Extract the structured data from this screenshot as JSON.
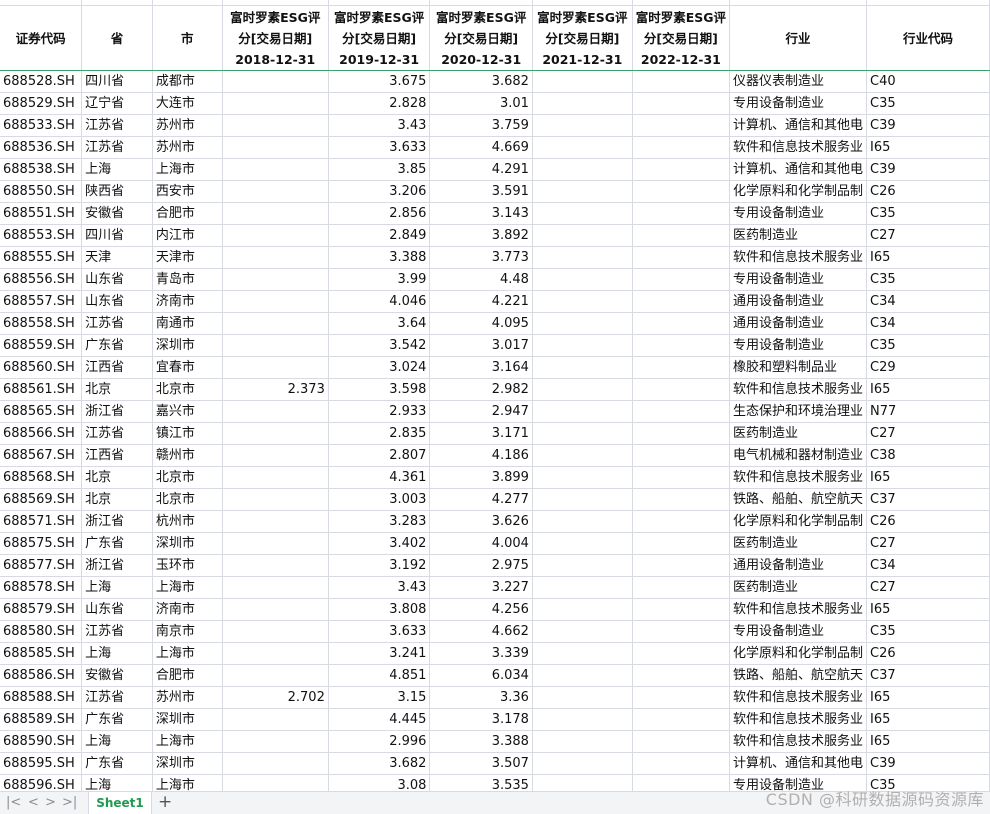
{
  "headers": [
    {
      "lines": [
        "证券代码"
      ]
    },
    {
      "lines": [
        "省"
      ]
    },
    {
      "lines": [
        "市"
      ]
    },
    {
      "lines": [
        "富时罗素ESG评",
        "分[交易日期]",
        "2018-12-31"
      ]
    },
    {
      "lines": [
        "富时罗素ESG评",
        "分[交易日期]",
        "2019-12-31"
      ]
    },
    {
      "lines": [
        "富时罗素ESG评",
        "分[交易日期]",
        "2020-12-31"
      ]
    },
    {
      "lines": [
        "富时罗素ESG评",
        "分[交易日期]",
        "2021-12-31"
      ]
    },
    {
      "lines": [
        "富时罗素ESG评",
        "分[交易日期]",
        "2022-12-31"
      ]
    },
    {
      "lines": [
        "行业"
      ]
    },
    {
      "lines": [
        "行业代码"
      ]
    }
  ],
  "rows": [
    [
      "688528.SH",
      "四川省",
      "成都市",
      "",
      "3.675",
      "3.682",
      "",
      "",
      "仪器仪表制造业",
      "C40"
    ],
    [
      "688529.SH",
      "辽宁省",
      "大连市",
      "",
      "2.828",
      "3.01",
      "",
      "",
      "专用设备制造业",
      "C35"
    ],
    [
      "688533.SH",
      "江苏省",
      "苏州市",
      "",
      "3.43",
      "3.759",
      "",
      "",
      "计算机、通信和其他电",
      "C39"
    ],
    [
      "688536.SH",
      "江苏省",
      "苏州市",
      "",
      "3.633",
      "4.669",
      "",
      "",
      "软件和信息技术服务业",
      "I65"
    ],
    [
      "688538.SH",
      "上海",
      "上海市",
      "",
      "3.85",
      "4.291",
      "",
      "",
      "计算机、通信和其他电",
      "C39"
    ],
    [
      "688550.SH",
      "陕西省",
      "西安市",
      "",
      "3.206",
      "3.591",
      "",
      "",
      "化学原料和化学制品制",
      "C26"
    ],
    [
      "688551.SH",
      "安徽省",
      "合肥市",
      "",
      "2.856",
      "3.143",
      "",
      "",
      "专用设备制造业",
      "C35"
    ],
    [
      "688553.SH",
      "四川省",
      "内江市",
      "",
      "2.849",
      "3.892",
      "",
      "",
      "医药制造业",
      "C27"
    ],
    [
      "688555.SH",
      "天津",
      "天津市",
      "",
      "3.388",
      "3.773",
      "",
      "",
      "软件和信息技术服务业",
      "I65"
    ],
    [
      "688556.SH",
      "山东省",
      "青岛市",
      "",
      "3.99",
      "4.48",
      "",
      "",
      "专用设备制造业",
      "C35"
    ],
    [
      "688557.SH",
      "山东省",
      "济南市",
      "",
      "4.046",
      "4.221",
      "",
      "",
      "通用设备制造业",
      "C34"
    ],
    [
      "688558.SH",
      "江苏省",
      "南通市",
      "",
      "3.64",
      "4.095",
      "",
      "",
      "通用设备制造业",
      "C34"
    ],
    [
      "688559.SH",
      "广东省",
      "深圳市",
      "",
      "3.542",
      "3.017",
      "",
      "",
      "专用设备制造业",
      "C35"
    ],
    [
      "688560.SH",
      "江西省",
      "宜春市",
      "",
      "3.024",
      "3.164",
      "",
      "",
      "橡胶和塑料制品业",
      "C29"
    ],
    [
      "688561.SH",
      "北京",
      "北京市",
      "2.373",
      "3.598",
      "2.982",
      "",
      "",
      "软件和信息技术服务业",
      "I65"
    ],
    [
      "688565.SH",
      "浙江省",
      "嘉兴市",
      "",
      "2.933",
      "2.947",
      "",
      "",
      "生态保护和环境治理业",
      "N77"
    ],
    [
      "688566.SH",
      "江苏省",
      "镇江市",
      "",
      "2.835",
      "3.171",
      "",
      "",
      "医药制造业",
      "C27"
    ],
    [
      "688567.SH",
      "江西省",
      "赣州市",
      "",
      "2.807",
      "4.186",
      "",
      "",
      "电气机械和器材制造业",
      "C38"
    ],
    [
      "688568.SH",
      "北京",
      "北京市",
      "",
      "4.361",
      "3.899",
      "",
      "",
      "软件和信息技术服务业",
      "I65"
    ],
    [
      "688569.SH",
      "北京",
      "北京市",
      "",
      "3.003",
      "4.277",
      "",
      "",
      "铁路、船舶、航空航天",
      "C37"
    ],
    [
      "688571.SH",
      "浙江省",
      "杭州市",
      "",
      "3.283",
      "3.626",
      "",
      "",
      "化学原料和化学制品制",
      "C26"
    ],
    [
      "688575.SH",
      "广东省",
      "深圳市",
      "",
      "3.402",
      "4.004",
      "",
      "",
      "医药制造业",
      "C27"
    ],
    [
      "688577.SH",
      "浙江省",
      "玉环市",
      "",
      "3.192",
      "2.975",
      "",
      "",
      "通用设备制造业",
      "C34"
    ],
    [
      "688578.SH",
      "上海",
      "上海市",
      "",
      "3.43",
      "3.227",
      "",
      "",
      "医药制造业",
      "C27"
    ],
    [
      "688579.SH",
      "山东省",
      "济南市",
      "",
      "3.808",
      "4.256",
      "",
      "",
      "软件和信息技术服务业",
      "I65"
    ],
    [
      "688580.SH",
      "江苏省",
      "南京市",
      "",
      "3.633",
      "4.662",
      "",
      "",
      "专用设备制造业",
      "C35"
    ],
    [
      "688585.SH",
      "上海",
      "上海市",
      "",
      "3.241",
      "3.339",
      "",
      "",
      "化学原料和化学制品制",
      "C26"
    ],
    [
      "688586.SH",
      "安徽省",
      "合肥市",
      "",
      "4.851",
      "6.034",
      "",
      "",
      "铁路、船舶、航空航天",
      "C37"
    ],
    [
      "688588.SH",
      "江苏省",
      "苏州市",
      "2.702",
      "3.15",
      "3.36",
      "",
      "",
      "软件和信息技术服务业",
      "I65"
    ],
    [
      "688589.SH",
      "广东省",
      "深圳市",
      "",
      "4.445",
      "3.178",
      "",
      "",
      "软件和信息技术服务业",
      "I65"
    ],
    [
      "688590.SH",
      "上海",
      "上海市",
      "",
      "2.996",
      "3.388",
      "",
      "",
      "软件和信息技术服务业",
      "I65"
    ],
    [
      "688595.SH",
      "广东省",
      "深圳市",
      "",
      "3.682",
      "3.507",
      "",
      "",
      "计算机、通信和其他电",
      "C39"
    ],
    [
      "688596.SH",
      "上海",
      "上海市",
      "",
      "3.08",
      "3.535",
      "",
      "",
      "专用设备制造业",
      "C35"
    ]
  ],
  "footer": {
    "nav_first": "|<",
    "nav_prev": "<",
    "nav_next": ">",
    "nav_last": ">|",
    "active_sheet": "Sheet1",
    "add_sheet": "+"
  },
  "watermark": "CSDN @科研数据源码资源库",
  "colors": {
    "accent": "#1f9b4f",
    "grid": "#d7dae0",
    "header_rule": "#3aa36a"
  }
}
